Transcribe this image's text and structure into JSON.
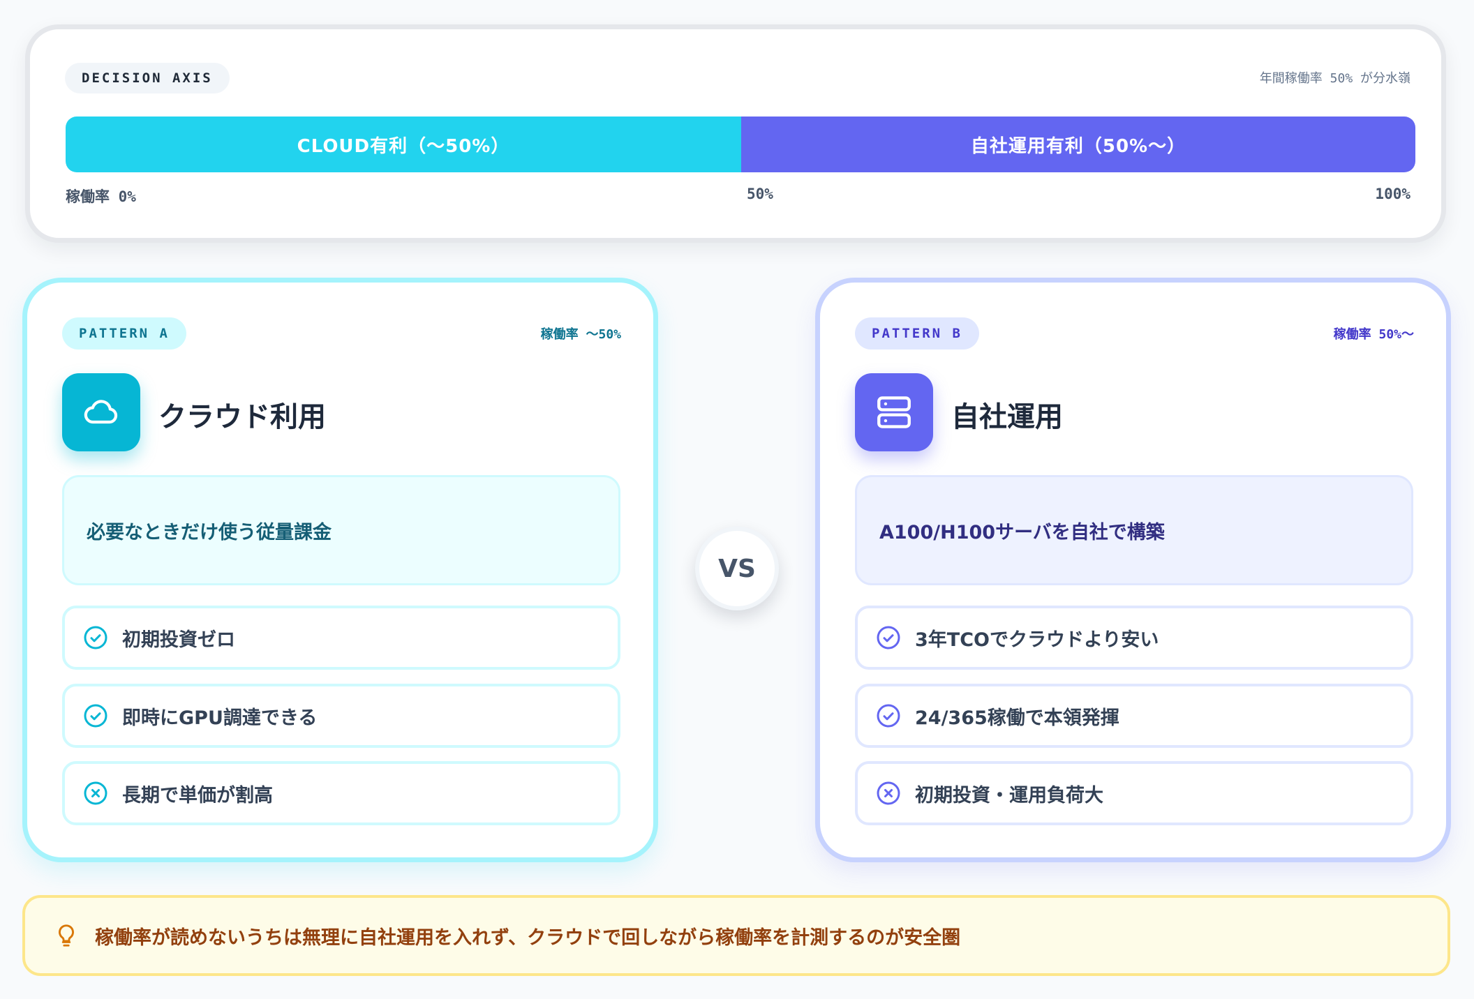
{
  "axis": {
    "label": "DECISION AXIS",
    "note": "年間稼働率 50% が分水嶺",
    "cloud_segment": "CLOUD有利（〜50%）",
    "onprem_segment": "自社運用有利（50%〜）",
    "split_fraction": 0.5,
    "tick_start": "稼働率 0%",
    "tick_mid": "50%",
    "tick_end": "100%"
  },
  "pattern_a": {
    "pill": "PATTERN A",
    "utilization": "稼働率 〜50%",
    "icon": "cloud-icon",
    "title": "クラウド利用",
    "description": "必要なときだけ使う従量課金",
    "items": [
      {
        "text": "初期投資ゼロ",
        "icon": "check-circle-icon"
      },
      {
        "text": "即時にGPU調達できる",
        "icon": "check-circle-icon"
      },
      {
        "text": "長期で単価が割高",
        "icon": "x-circle-icon"
      }
    ]
  },
  "pattern_b": {
    "pill": "PATTERN B",
    "utilization": "稼働率 50%〜",
    "icon": "server-icon",
    "title": "自社運用",
    "description": "A100/H100サーバを自社で構築",
    "items": [
      {
        "text": "3年TCOでクラウドより安い",
        "icon": "check-circle-icon"
      },
      {
        "text": "24/365稼働で本領発揮",
        "icon": "check-circle-icon"
      },
      {
        "text": "初期投資・運用負荷大",
        "icon": "x-circle-icon"
      }
    ]
  },
  "vs_label": "VS",
  "tip": {
    "icon": "lightbulb-icon",
    "text": "稼働率が読めないうちは無理に自社運用を入れず、クラウドで回しながら稼働率を計測するのが安全圏"
  },
  "colors": {
    "cloud": "#22d3ee",
    "cloud_dark": "#06b6d4",
    "onprem": "#6366f1",
    "tip_text": "#92400e"
  }
}
